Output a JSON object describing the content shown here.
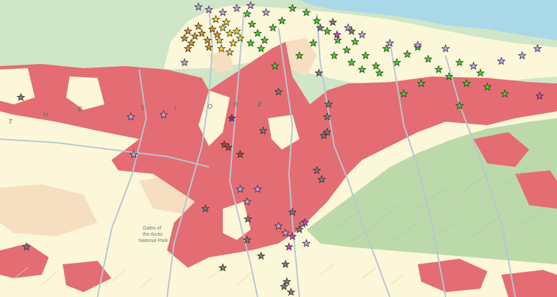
{
  "map": {
    "colors": {
      "ocean": "#a9d8e8",
      "lowland": "#fbf7d8",
      "tundra": "#cfe6c8",
      "alluvium": "#f6dfc0",
      "bedrock": "#e36d73",
      "foothills": "#bcd9a9",
      "river": "#b8c6d2"
    },
    "region_label_letters": [
      "T",
      "H",
      "E",
      "S",
      "L",
      "O",
      "P",
      "E"
    ],
    "park_label_lines": [
      "Gates of",
      "the Arctic",
      "National Park"
    ],
    "marker_legend": [
      {
        "category": "orange",
        "color": "#e8901c"
      },
      {
        "category": "yellow",
        "color": "#f2d33a"
      },
      {
        "category": "green",
        "color": "#39d820"
      },
      {
        "category": "lavender",
        "color": "#c7a0e8"
      },
      {
        "category": "magenta",
        "color": "#d83cc8"
      },
      {
        "category": "gray",
        "color": "#7a7a7a"
      },
      {
        "category": "brown",
        "color": "#b0481c"
      },
      {
        "category": "purple",
        "color": "#8a2ca0"
      }
    ]
  }
}
